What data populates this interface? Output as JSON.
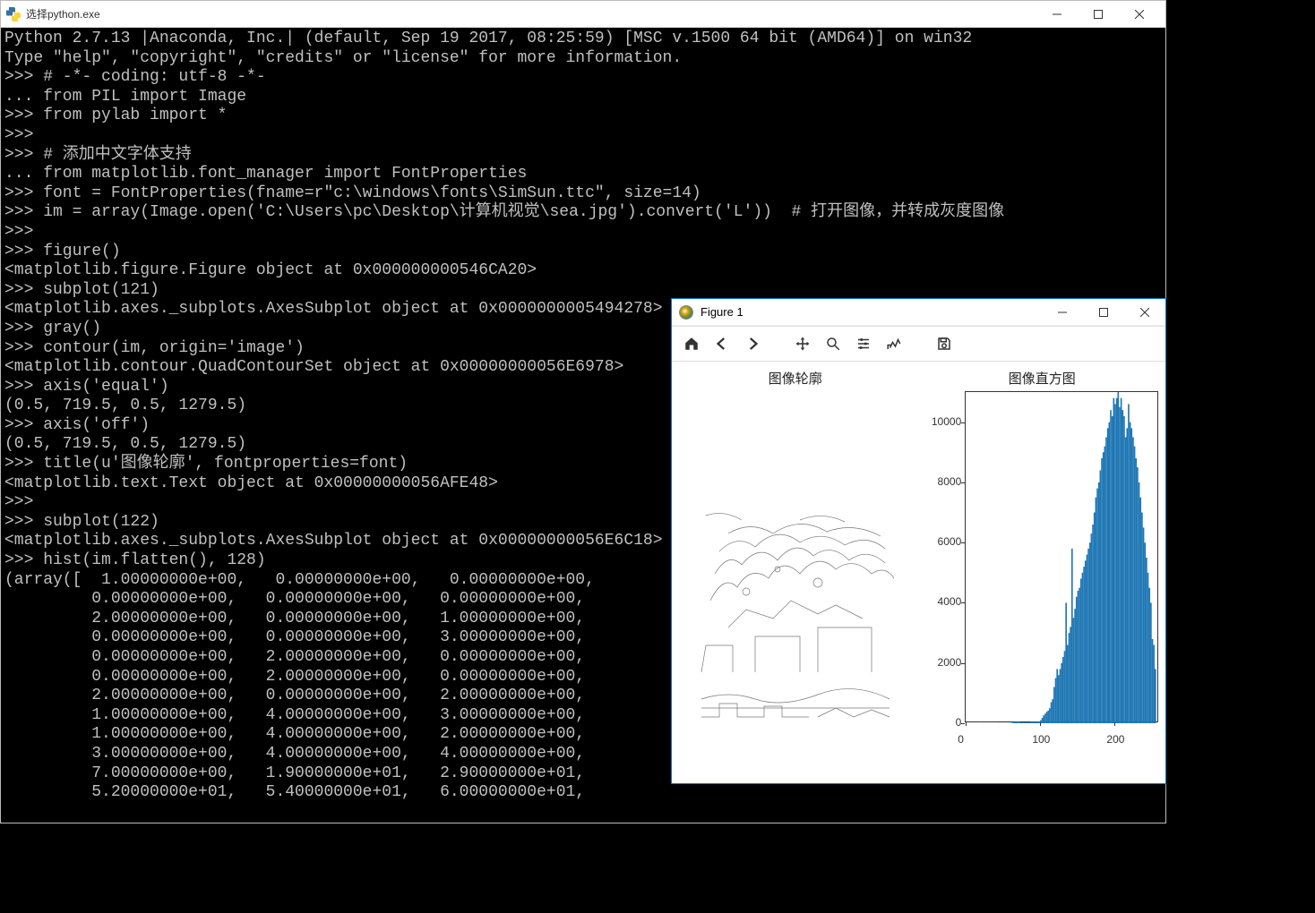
{
  "console": {
    "title": "选择python.exe",
    "lines": [
      "Python 2.7.13 |Anaconda, Inc.| (default, Sep 19 2017, 08:25:59) [MSC v.1500 64 bit (AMD64)] on win32",
      "Type \"help\", \"copyright\", \"credits\" or \"license\" for more information.",
      ">>> # -*- coding: utf-8 -*-",
      "... from PIL import Image",
      ">>> from pylab import *",
      ">>>",
      ">>> # 添加中文字体支持",
      "... from matplotlib.font_manager import FontProperties",
      ">>> font = FontProperties(fname=r\"c:\\windows\\fonts\\SimSun.ttc\", size=14)",
      ">>> im = array(Image.open('C:\\Users\\pc\\Desktop\\计算机视觉\\sea.jpg').convert('L'))  # 打开图像，并转成灰度图像",
      ">>>",
      ">>> figure()",
      "<matplotlib.figure.Figure object at 0x000000000546CA20>",
      ">>> subplot(121)",
      "<matplotlib.axes._subplots.AxesSubplot object at 0x0000000005494278>",
      ">>> gray()",
      ">>> contour(im, origin='image')",
      "<matplotlib.contour.QuadContourSet object at 0x00000000056E6978>",
      ">>> axis('equal')",
      "(0.5, 719.5, 0.5, 1279.5)",
      ">>> axis('off')",
      "(0.5, 719.5, 0.5, 1279.5)",
      ">>> title(u'图像轮廓', fontproperties=font)",
      "<matplotlib.text.Text object at 0x00000000056AFE48>",
      ">>>",
      ">>> subplot(122)",
      "<matplotlib.axes._subplots.AxesSubplot object at 0x00000000056E6C18>",
      ">>> hist(im.flatten(), 128)",
      "(array([  1.00000000e+00,   0.00000000e+00,   0.00000000e+00,",
      "         0.00000000e+00,   0.00000000e+00,   0.00000000e+00,",
      "         2.00000000e+00,   0.00000000e+00,   1.00000000e+00,",
      "         0.00000000e+00,   0.00000000e+00,   3.00000000e+00,",
      "         0.00000000e+00,   2.00000000e+00,   0.00000000e+00,",
      "         0.00000000e+00,   2.00000000e+00,   0.00000000e+00,",
      "         2.00000000e+00,   0.00000000e+00,   2.00000000e+00,",
      "         1.00000000e+00,   4.00000000e+00,   3.00000000e+00,",
      "         1.00000000e+00,   4.00000000e+00,   2.00000000e+00,",
      "         3.00000000e+00,   4.00000000e+00,   4.00000000e+00,",
      "         7.00000000e+00,   1.90000000e+01,   2.90000000e+01,",
      "         5.20000000e+01,   5.40000000e+01,   6.00000000e+01,"
    ]
  },
  "figure": {
    "title": "Figure 1",
    "toolbar": {
      "home": "Home",
      "back": "Back",
      "forward": "Forward",
      "pan": "Pan",
      "zoom": "Zoom",
      "config": "Configure",
      "edit": "Edit",
      "save": "Save"
    },
    "subplot_left_title": "图像轮廓",
    "subplot_right_title": "图像直方图"
  },
  "chart_data": {
    "type": "bar",
    "title": "图像直方图",
    "xlabel": "",
    "ylabel": "",
    "xlim": [
      0,
      260
    ],
    "ylim": [
      0,
      11000
    ],
    "xticks": [
      0,
      100,
      200
    ],
    "yticks": [
      0,
      2000,
      4000,
      6000,
      8000,
      10000
    ],
    "bin_width": 2,
    "x": [
      0,
      2,
      4,
      6,
      8,
      10,
      12,
      14,
      16,
      18,
      20,
      22,
      24,
      26,
      28,
      30,
      32,
      34,
      36,
      38,
      40,
      42,
      44,
      46,
      48,
      50,
      52,
      54,
      56,
      58,
      60,
      62,
      64,
      66,
      68,
      70,
      72,
      74,
      76,
      78,
      80,
      82,
      84,
      86,
      88,
      90,
      92,
      94,
      96,
      98,
      100,
      102,
      104,
      106,
      108,
      110,
      112,
      114,
      116,
      118,
      120,
      122,
      124,
      126,
      128,
      130,
      132,
      134,
      136,
      138,
      140,
      142,
      144,
      146,
      148,
      150,
      152,
      154,
      156,
      158,
      160,
      162,
      164,
      166,
      168,
      170,
      172,
      174,
      176,
      178,
      180,
      182,
      184,
      186,
      188,
      190,
      192,
      194,
      196,
      198,
      200,
      202,
      204,
      206,
      208,
      210,
      212,
      214,
      216,
      218,
      220,
      222,
      224,
      226,
      228,
      230,
      232,
      234,
      236,
      238,
      240,
      242,
      244,
      246,
      248,
      250,
      252,
      254
    ],
    "values": [
      1,
      0,
      0,
      0,
      0,
      0,
      2,
      0,
      1,
      0,
      0,
      3,
      0,
      2,
      0,
      0,
      2,
      0,
      2,
      0,
      2,
      1,
      4,
      3,
      1,
      4,
      2,
      3,
      4,
      4,
      7,
      19,
      29,
      52,
      54,
      60,
      40,
      35,
      30,
      30,
      28,
      30,
      35,
      40,
      50,
      55,
      45,
      50,
      55,
      60,
      100,
      180,
      260,
      320,
      380,
      420,
      500,
      700,
      800,
      1200,
      1500,
      1800,
      1600,
      1800,
      2000,
      2200,
      2400,
      4000,
      2600,
      3000,
      3200,
      5800,
      3500,
      3800,
      4200,
      4400,
      4500,
      4800,
      5000,
      5200,
      5400,
      5600,
      5800,
      6000,
      6300,
      6600,
      7000,
      7500,
      7800,
      8000,
      8400,
      8800,
      9000,
      9200,
      9500,
      9800,
      10000,
      10400,
      10200,
      10800,
      10600,
      10800,
      11000,
      10500,
      10800,
      10400,
      10200,
      9500,
      9800,
      10600,
      10000,
      9800,
      9500,
      9200,
      8800,
      8500,
      8000,
      7500,
      7000,
      6500,
      6000,
      5500,
      5000,
      4500,
      4000,
      2800,
      2600,
      1800
    ]
  }
}
